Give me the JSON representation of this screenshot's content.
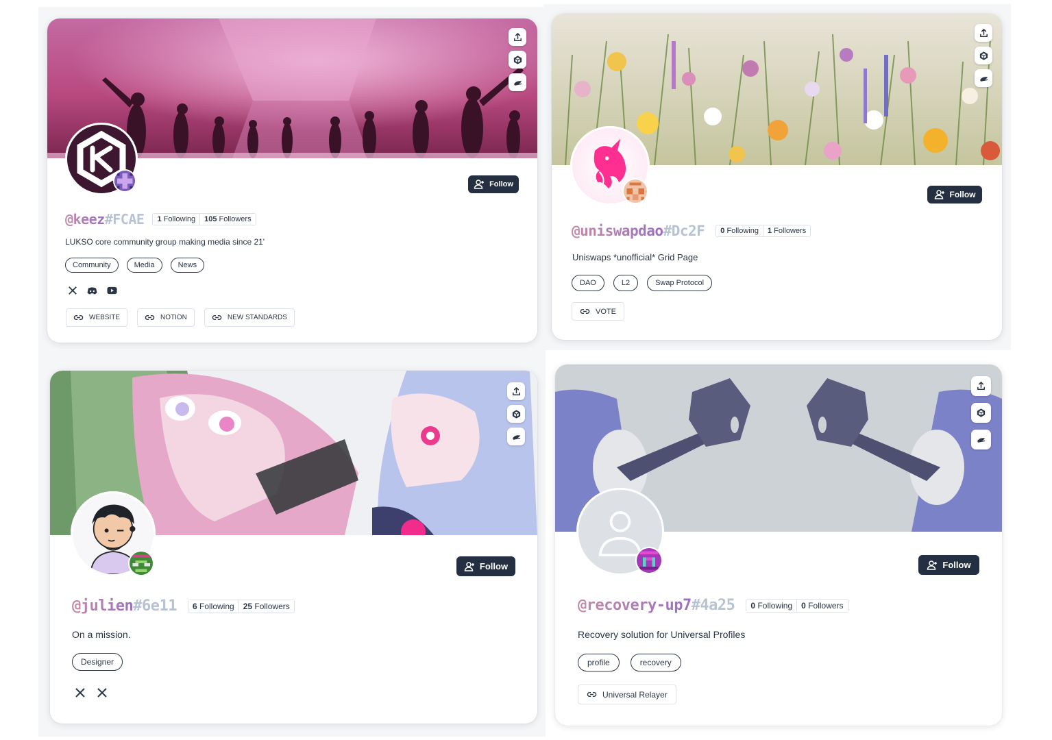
{
  "profiles": [
    {
      "handle": "@keez",
      "hash": "#FCAE",
      "following": "1",
      "following_label": "Following",
      "followers": "105",
      "followers_label": "Followers",
      "description": "LUKSO core community group making media since 21'",
      "tags": [
        "Community",
        "Media",
        "News"
      ],
      "socials": [
        "x-icon",
        "discord-icon",
        "youtube-icon"
      ],
      "links": [
        "WEBSITE",
        "NOTION",
        "NEW STANDARDS"
      ],
      "follow_label": "Follow",
      "banner_theme": "pink-concert",
      "accent": "#c24d8e"
    },
    {
      "handle": "@uniswapdao",
      "hash": "#Dc2F",
      "following": "0",
      "following_label": "Following",
      "followers": "1",
      "followers_label": "Followers",
      "description": "Uniswaps *unofficial* Grid Page",
      "tags": [
        "DAO",
        "L2",
        "Swap Protocol"
      ],
      "socials": [],
      "links": [
        "VOTE"
      ],
      "follow_label": "Follow",
      "banner_theme": "wildflowers",
      "accent": "#ff007a"
    },
    {
      "handle": "@julien",
      "hash": "#6e11",
      "following": "6",
      "following_label": "Following",
      "followers": "25",
      "followers_label": "Followers",
      "description": "On a mission.",
      "tags": [
        "Designer"
      ],
      "socials": [
        "x-icon",
        "x-icon"
      ],
      "links": [],
      "follow_label": "Follow",
      "banner_theme": "anime",
      "accent": "#d85ca8"
    },
    {
      "handle": "@recovery-up7",
      "hash": "#4a25",
      "following": "0",
      "following_label": "Following",
      "followers": "0",
      "followers_label": "Followers",
      "description": "Recovery solution for Universal Profiles",
      "tags": [
        "profile",
        "recovery"
      ],
      "socials": [],
      "links": [
        "Universal Relayer"
      ],
      "follow_label": "Follow",
      "banner_theme": "keys",
      "accent": "#7d82c4"
    }
  ],
  "action_icons": [
    "upload-icon",
    "unity-icon",
    "universal-profile-icon"
  ],
  "colors": {
    "button_bg": "#243042",
    "text": "#2a3545",
    "border": "#dde2ea",
    "hash": "#b7c3d3"
  }
}
